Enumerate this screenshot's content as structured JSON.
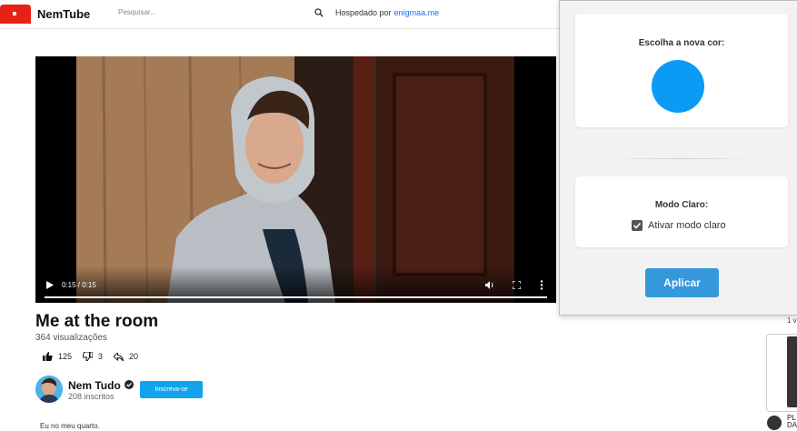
{
  "header": {
    "brand": "NemTube",
    "search_placeholder": "Pesquisar...",
    "hosted_label": "Hospedado por",
    "hosted_link": "enigmaa.me"
  },
  "player": {
    "time": "0:15 / 0:15",
    "progress": 1.0
  },
  "video": {
    "title": "Me at the room",
    "views": "364 visualizações",
    "likes": "125",
    "dislikes": "3",
    "shares": "20",
    "description": "Eu no meu quarto."
  },
  "channel": {
    "name": "Nem Tudo",
    "subscribers": "208 inscritos",
    "subscribe_label": "Inscreva-se"
  },
  "sidebar": {
    "views_partial": "1 v",
    "title_line1": "PL",
    "title_line2": "DA"
  },
  "settings": {
    "color_title": "Escolha a nova cor:",
    "selected_color": "#0b9bf5",
    "mode_title": "Modo Claro:",
    "light_mode_label": "Ativar modo claro",
    "light_mode_checked": true,
    "apply_label": "Aplicar"
  },
  "colors": {
    "brand_red": "#e62117",
    "accent_blue": "#12a3ee",
    "apply_blue": "#3498db"
  }
}
